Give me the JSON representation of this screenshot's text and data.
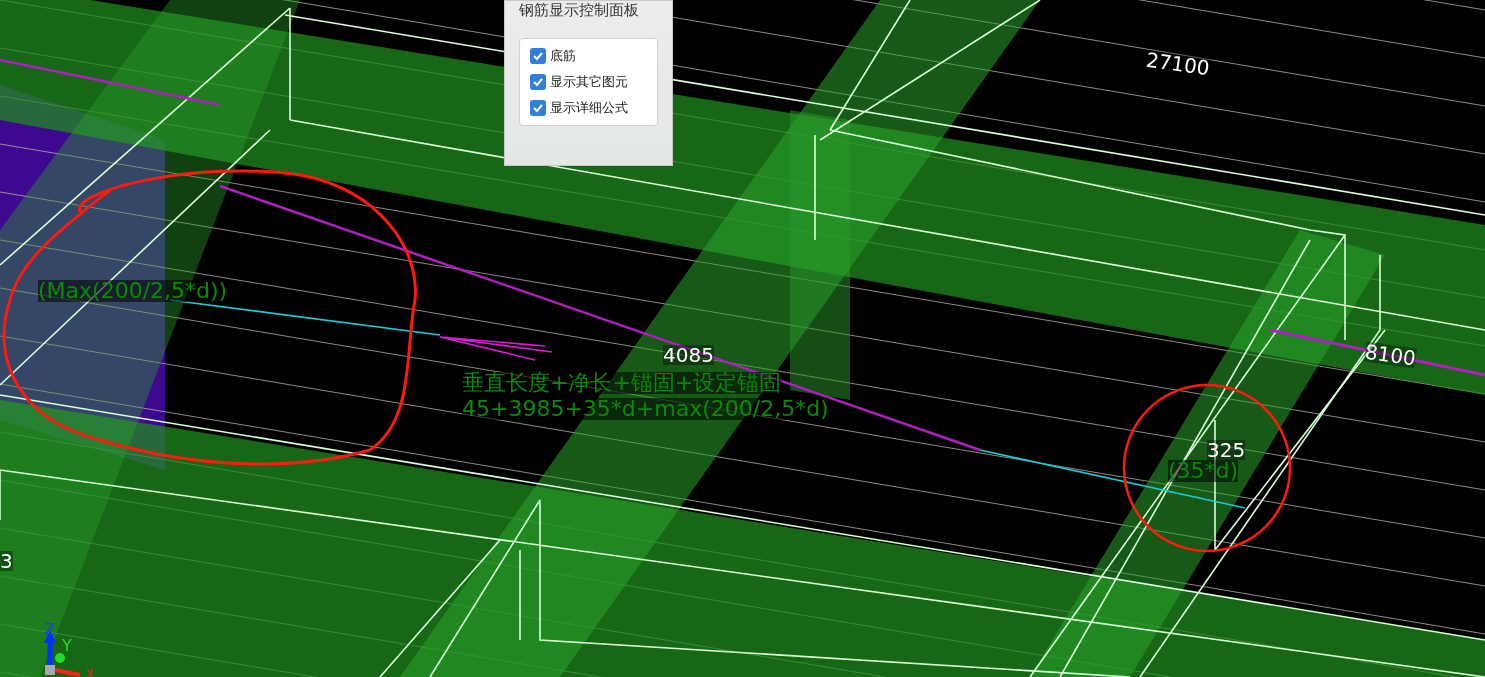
{
  "viewport": {
    "labels": [
      {
        "kind": "dimension",
        "text": "27100"
      },
      {
        "kind": "dimension",
        "text": "8100"
      },
      {
        "kind": "dimension",
        "text": "4085"
      },
      {
        "kind": "dimension",
        "text": "325"
      },
      {
        "kind": "dimension",
        "text": "3"
      },
      {
        "kind": "formula",
        "text": "(Max(200/2,5*d))"
      },
      {
        "kind": "formula",
        "text": "垂直长度+净长+锚固+设定锚固"
      },
      {
        "kind": "formula",
        "text": "45+3985+35*d+max(200/2,5*d)"
      },
      {
        "kind": "formula",
        "text": "(35*d)"
      }
    ],
    "axes": [
      {
        "kind": "z",
        "text": "Z"
      },
      {
        "kind": "y",
        "text": "Y"
      },
      {
        "kind": "x",
        "text": "X"
      }
    ]
  },
  "panel": {
    "title": "钢筋显示控制面板",
    "options": [
      {
        "label": "底筋",
        "checked": true
      },
      {
        "label": "显示其它图元",
        "checked": true
      },
      {
        "label": "显示详细公式",
        "checked": true
      }
    ]
  }
}
